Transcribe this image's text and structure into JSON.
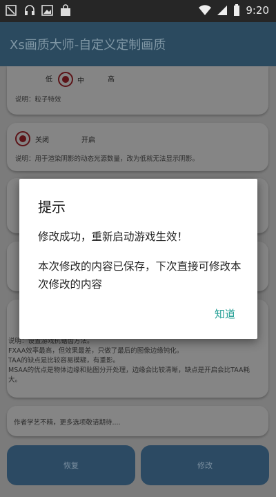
{
  "status_bar": {
    "time": "9:20",
    "icons": [
      "debug-icon",
      "headset-icon",
      "image-icon",
      "bag-icon",
      "wifi-icon",
      "signal-icon",
      "battery-icon"
    ]
  },
  "app_bar": {
    "title": "Xs画质大师-自定义定制画质"
  },
  "card1": {
    "options": [
      "低",
      "中",
      "高"
    ],
    "selected": "中",
    "description": "说明：粒子特效"
  },
  "card2": {
    "options": [
      "关闭",
      "开启"
    ],
    "selected": "关闭",
    "description": "说明：用于渲染阴影的动态光源数量，改为低就无法显示阴影。"
  },
  "aa_description": [
    "说明：设置游戏抗锯齿方法。",
    "FXAA效率最高，但效果最差，只做了最后的图像边缘钝化。",
    "TAA的缺点是比较容易模糊，有重影。",
    "MSAA的优点是物体边缘和贴图分开处理，边缘会比较清晰，缺点是开启会比TAA耗大。"
  ],
  "author_note": "作者学艺不精，更多选项敬请期待....",
  "buttons": {
    "restore": "恢复",
    "modify": "修改"
  },
  "dialog": {
    "title": "提示",
    "message1": "修改成功，重新启动游戏生效！",
    "message2": "本次修改的内容已保存，下次直接可修改本次修改的内容",
    "ok": "知道"
  },
  "colors": {
    "app_bar": "#2b4a5f",
    "accent_teal": "#1e9c92",
    "radio_selected": "#5c1418",
    "scrim": "#7b7b7b"
  }
}
